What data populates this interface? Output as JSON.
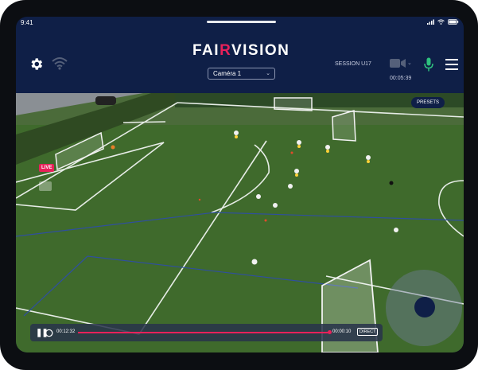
{
  "status_bar": {
    "time": "9:41"
  },
  "header": {
    "brand_prefix": "FAI",
    "brand_mid": "R",
    "brand_suffix": "VISION",
    "camera_select": "Caméra 1",
    "session": "SESSION U17",
    "recording_time": "00:05:39"
  },
  "icons": {
    "settings": "gear-icon",
    "network": "wifi-icon",
    "camera": "video-camera-icon",
    "microphone": "microphone-icon",
    "menu": "hamburger-menu-icon"
  },
  "overlay": {
    "live_badge": "LIVE",
    "presets_label": "PRESETS"
  },
  "playback": {
    "current_time": "00:12:32",
    "remaining_time": "00:00:10",
    "direct_label": "DIRECT",
    "progress": 0.99
  },
  "colors": {
    "navy": "#0f1f47",
    "accent": "#e8215a",
    "mic_green": "#2ec27e",
    "pitch": "#3d6a2b"
  }
}
